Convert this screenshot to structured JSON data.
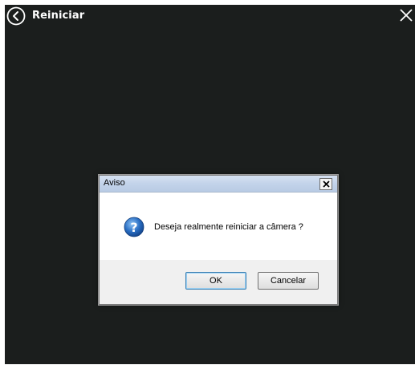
{
  "app": {
    "title": "Reiniciar",
    "back_icon": "circle-chevron-left-icon",
    "close_icon": "close-x-icon",
    "background": "#1b1e1d"
  },
  "dialog": {
    "title": "Aviso",
    "close_glyph": "✕",
    "message": "Deseja realmente reiniciar a câmera ?",
    "icon": "question-icon",
    "ok_label": "OK",
    "cancel_label": "Cancelar"
  }
}
